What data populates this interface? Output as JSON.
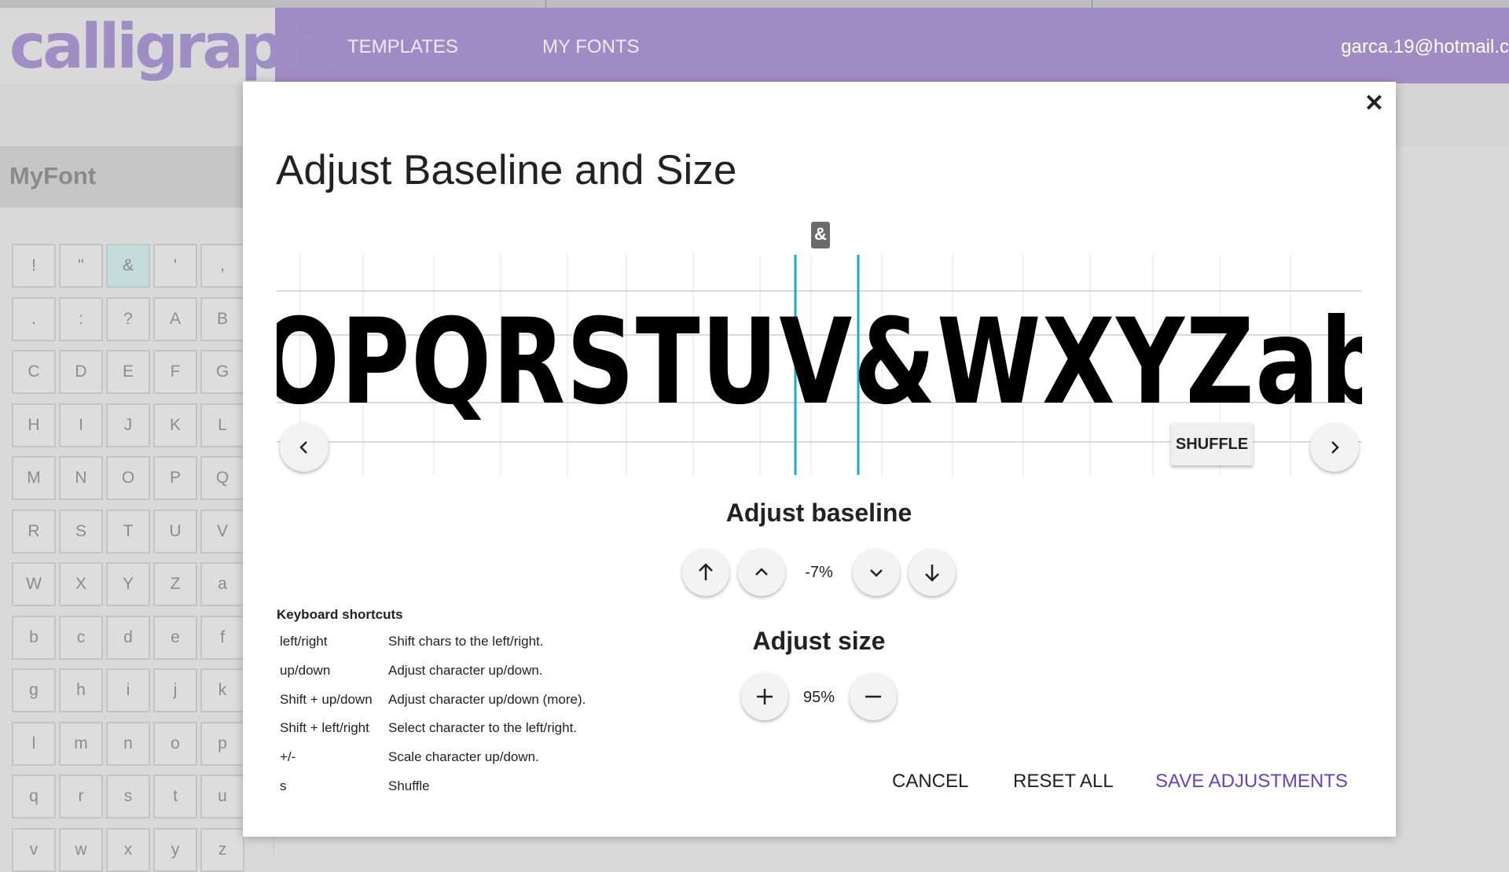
{
  "app": {
    "logo": "calligraphr",
    "nav": [
      "TEMPLATES",
      "MY FONTS"
    ],
    "user": "garca.19@hotmail.c"
  },
  "sidebar": {
    "font_name": "MyFont",
    "selected_char": "&",
    "chars": [
      "!",
      "\"",
      "&",
      "'",
      ",",
      ".",
      ":",
      "?",
      "A",
      "B",
      "C",
      "D",
      "E",
      "F",
      "G",
      "H",
      "I",
      "J",
      "K",
      "L",
      "M",
      "N",
      "O",
      "P",
      "Q",
      "R",
      "S",
      "T",
      "U",
      "V",
      "W",
      "X",
      "Y",
      "Z",
      "a",
      "b",
      "c",
      "d",
      "e",
      "f",
      "g",
      "h",
      "i",
      "j",
      "k",
      "l",
      "m",
      "n",
      "o",
      "p",
      "q",
      "r",
      "s",
      "t",
      "u",
      "v",
      "w",
      "x",
      "y",
      "z"
    ]
  },
  "modal": {
    "title": "Adjust Baseline and Size",
    "selected_char": "&",
    "sample_text": "OPQRSTUV&WXYZabcd",
    "shuffle_label": "SHUFFLE",
    "baseline_heading": "Adjust baseline",
    "baseline_value": "-7%",
    "size_heading": "Adjust size",
    "size_value": "95%",
    "shortcuts_title": "Keyboard shortcuts",
    "shortcuts": [
      {
        "key": "left/right",
        "desc": "Shift chars to the left/right."
      },
      {
        "key": "up/down",
        "desc": "Adjust character up/down."
      },
      {
        "key": "Shift + up/down",
        "desc": "Adjust character up/down (more)."
      },
      {
        "key": "Shift + left/right",
        "desc": "Select character to the left/right."
      },
      {
        "key": "+/-",
        "desc": "Scale character up/down."
      },
      {
        "key": "s",
        "desc": "Shuffle"
      }
    ],
    "buttons": {
      "cancel": "CANCEL",
      "reset": "RESET ALL",
      "save": "SAVE ADJUSTMENTS"
    }
  },
  "colors": {
    "header": "#a08cc4",
    "guide": "#1eaacc",
    "save_accent": "#6a3fc6"
  }
}
